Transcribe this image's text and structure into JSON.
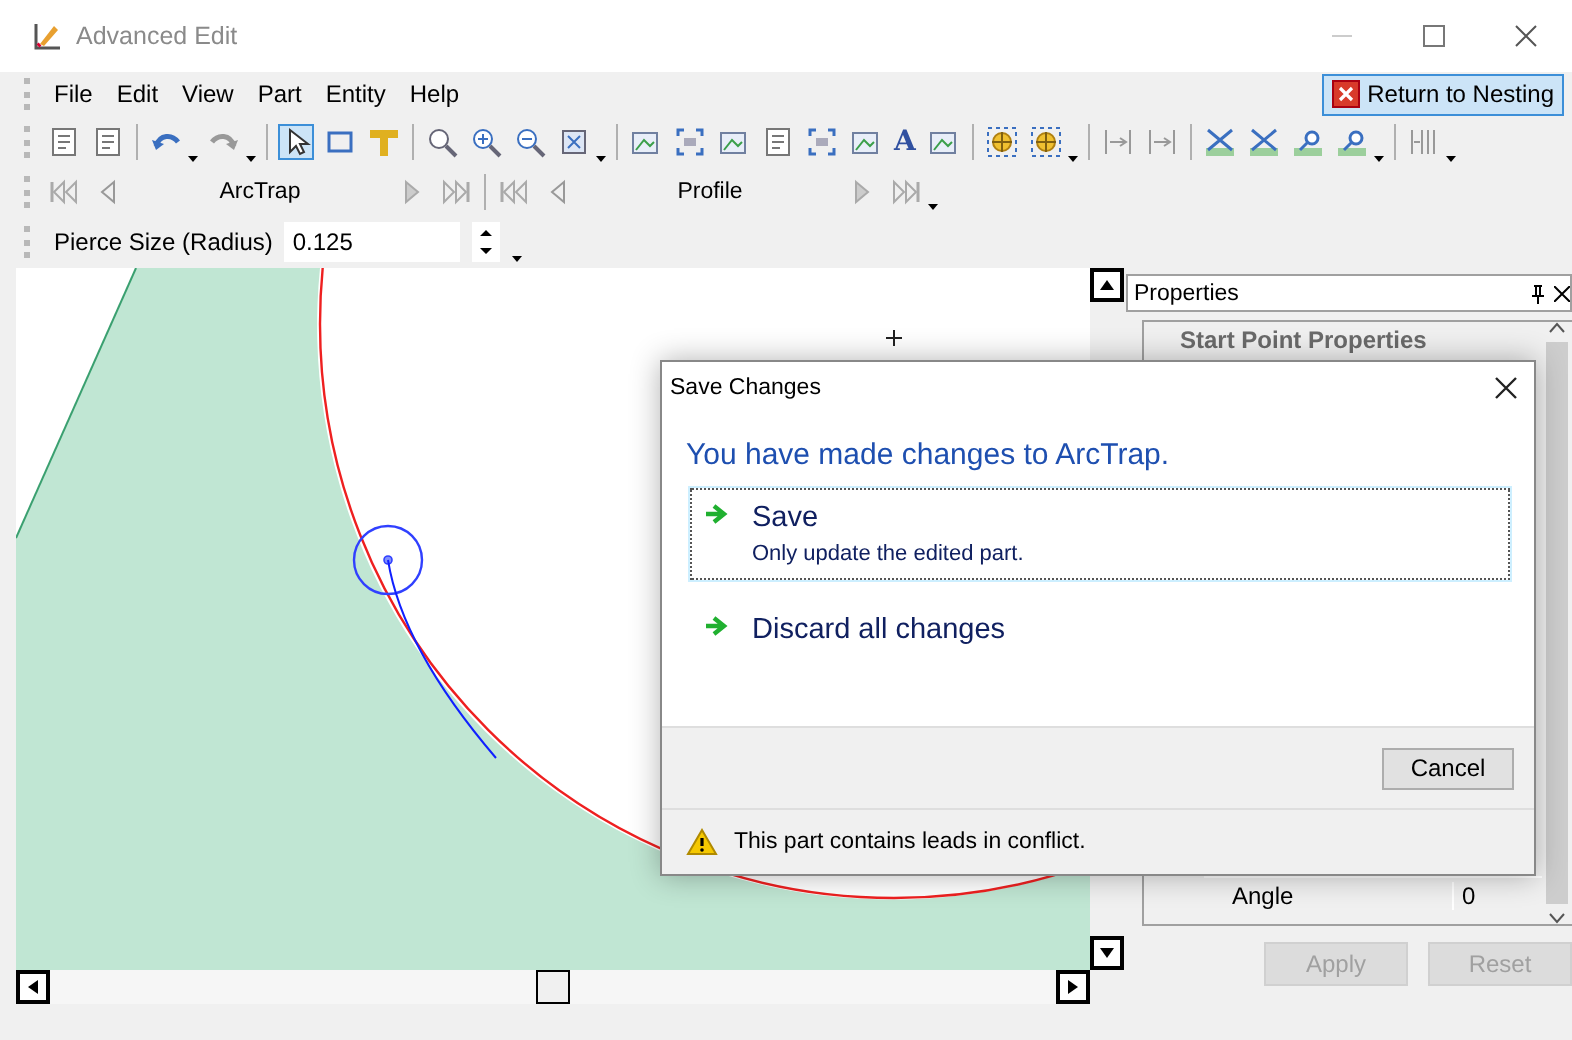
{
  "window": {
    "title": "Advanced Edit"
  },
  "menu": [
    {
      "label": "File"
    },
    {
      "label": "Edit"
    },
    {
      "label": "View"
    },
    {
      "label": "Part"
    },
    {
      "label": "Entity"
    },
    {
      "label": "Help"
    }
  ],
  "return_button": {
    "label": "Return to Nesting"
  },
  "toolbar": {
    "text_tool": "A"
  },
  "navigators": [
    {
      "label": "ArcTrap"
    },
    {
      "label": "Profile"
    }
  ],
  "pierce": {
    "label": "Pierce Size (Radius)",
    "value": "0.125"
  },
  "properties": {
    "title": "Properties",
    "section": "Start Point Properties",
    "rows": [
      {
        "name": "Angle",
        "value": "0"
      }
    ],
    "buttons": [
      {
        "label": "Apply",
        "disabled": true
      },
      {
        "label": "Reset",
        "disabled": true
      }
    ]
  },
  "dialog": {
    "title": "Save Changes",
    "heading": "You have made changes to ArcTrap.",
    "options": [
      {
        "label": "Save",
        "description": "Only update the edited part.",
        "selected": true
      },
      {
        "label": "Discard all changes",
        "selected": false
      }
    ],
    "cancel": "Cancel",
    "warning": "This part contains leads in conflict."
  }
}
